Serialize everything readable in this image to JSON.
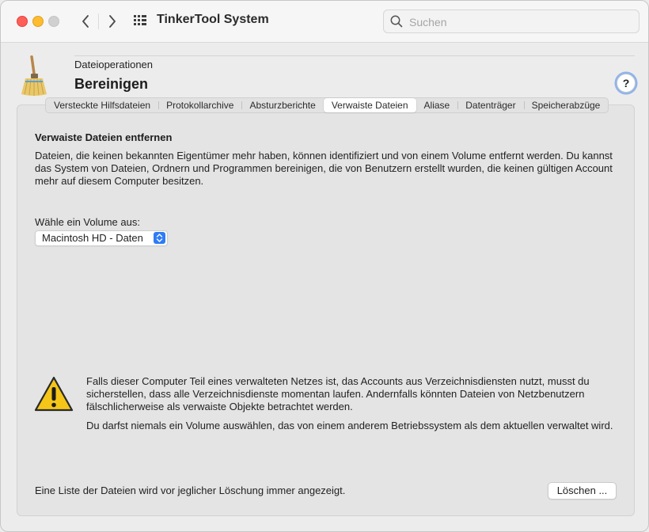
{
  "window": {
    "title": "TinkerTool System",
    "search_placeholder": "Suchen"
  },
  "header": {
    "section": "Dateioperationen",
    "title": "Bereinigen",
    "help_label": "?"
  },
  "tabs": [
    {
      "label": "Versteckte Hilfsdateien",
      "active": false
    },
    {
      "label": "Protokollarchive",
      "active": false
    },
    {
      "label": "Absturzberichte",
      "active": false
    },
    {
      "label": "Verwaiste Dateien",
      "active": true
    },
    {
      "label": "Aliase",
      "active": false
    },
    {
      "label": "Datenträger",
      "active": false
    },
    {
      "label": "Speicherabzüge",
      "active": false
    }
  ],
  "content": {
    "title": "Verwaiste Dateien entfernen",
    "description": "Dateien, die keinen bekannten Eigentümer mehr haben, können identifiziert und von einem Volume entfernt werden. Du kannst das System von Dateien, Ordnern und Programmen bereinigen, die von Benutzern erstellt wurden, die keinen gültigen Account mehr auf diesem Computer besitzen.",
    "volume_label": "Wähle ein Volume aus:",
    "volume_selected": "Macintosh HD - Daten",
    "warning_1": "Falls dieser Computer Teil eines verwalteten Netzes ist, das Accounts aus Verzeichnisdiensten nutzt, musst du sicherstellen, dass alle Verzeichnisdienste momentan laufen. Andernfalls könnten Dateien von Netzbenutzern fälschlicherweise als verwaiste Objekte betrachtet werden.",
    "warning_2": "Du darfst niemals ein Volume auswählen, das von einem anderem Betriebssystem als dem aktuellen verwaltet wird.",
    "footer_note": "Eine Liste der Dateien wird vor jeglicher Löschung immer angezeigt.",
    "delete_button": "Löschen ..."
  },
  "colors": {
    "accent": "#2f7bf5",
    "close": "#ff5f57",
    "minimize": "#febc2e",
    "warning": "#f5c518"
  },
  "icons": [
    "chevron-left-icon",
    "chevron-right-icon",
    "app-grid-icon",
    "search-icon",
    "broom-icon",
    "warning-icon",
    "updown-arrows-icon"
  ]
}
